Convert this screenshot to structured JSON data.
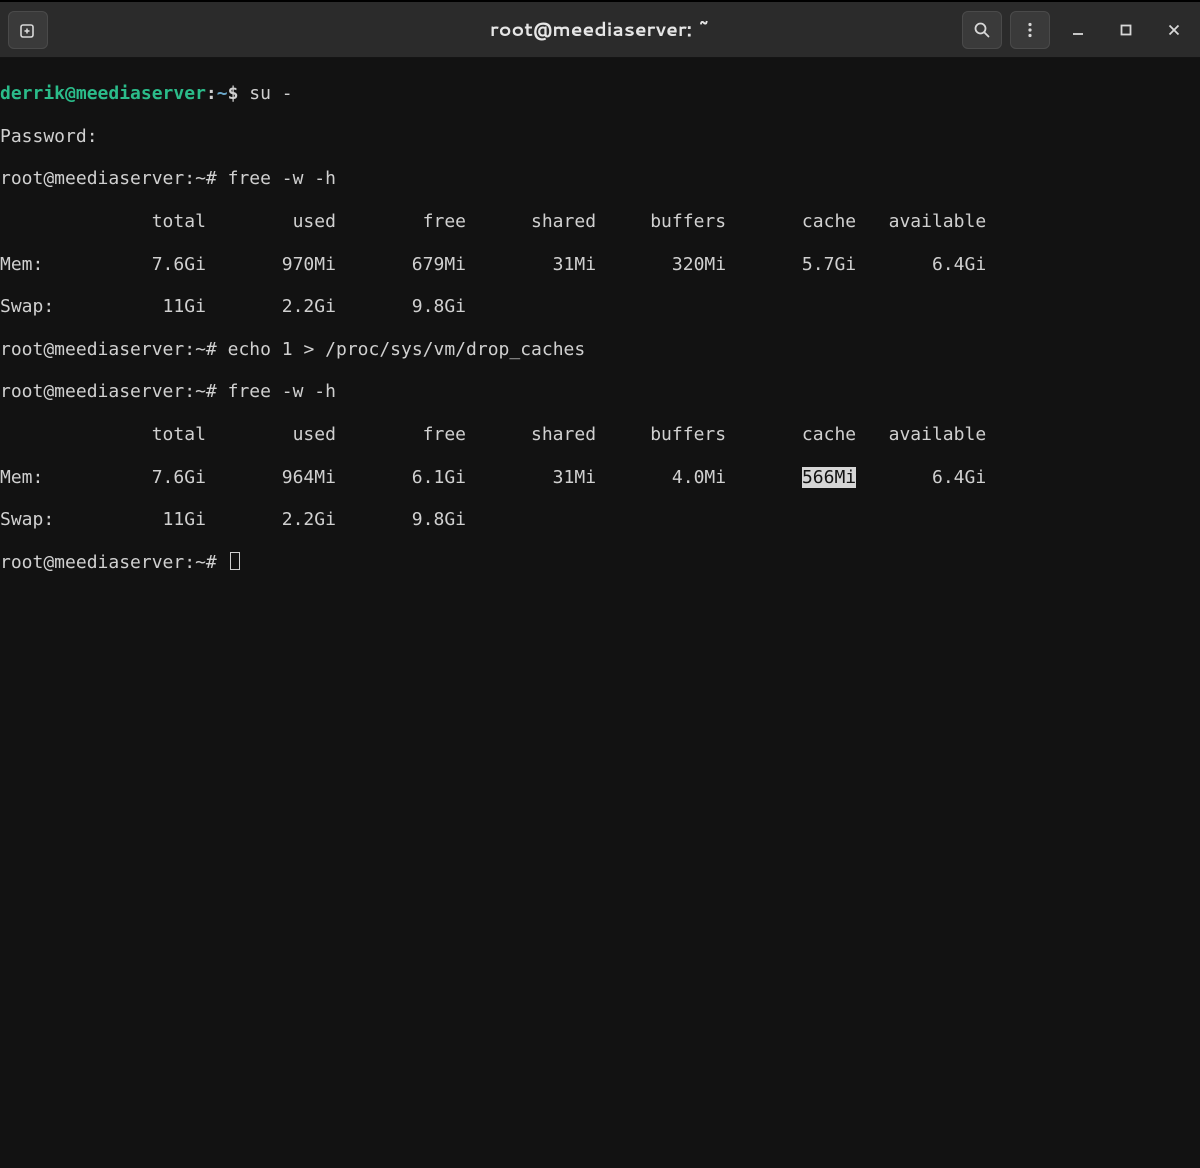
{
  "window": {
    "title": "root@meediaserver: ~"
  },
  "terminal": {
    "prompt_user_local": "derrik@meediaserver",
    "prompt_user_root": "root@meediaserver",
    "prompt_path": "~",
    "prompt_local_sym": "$",
    "prompt_root_sym": "#",
    "cmd_su": "su -",
    "password_label": "Password:",
    "cmd_free": "free -w -h",
    "cmd_drop": "echo 1 > /proc/sys/vm/drop_caches",
    "header": "              total        used        free      shared     buffers       cache   available",
    "free1_mem": "Mem:          7.6Gi       970Mi       679Mi        31Mi       320Mi       5.7Gi       6.4Gi",
    "free1_swap": "Swap:          11Gi       2.2Gi       9.8Gi",
    "free2_mem_pre": "Mem:          7.6Gi       964Mi       6.1Gi        31Mi       4.0Mi       ",
    "free2_mem_hl": "566Mi",
    "free2_mem_post": "       6.4Gi",
    "free2_swap": "Swap:          11Gi       2.2Gi       9.8Gi"
  }
}
